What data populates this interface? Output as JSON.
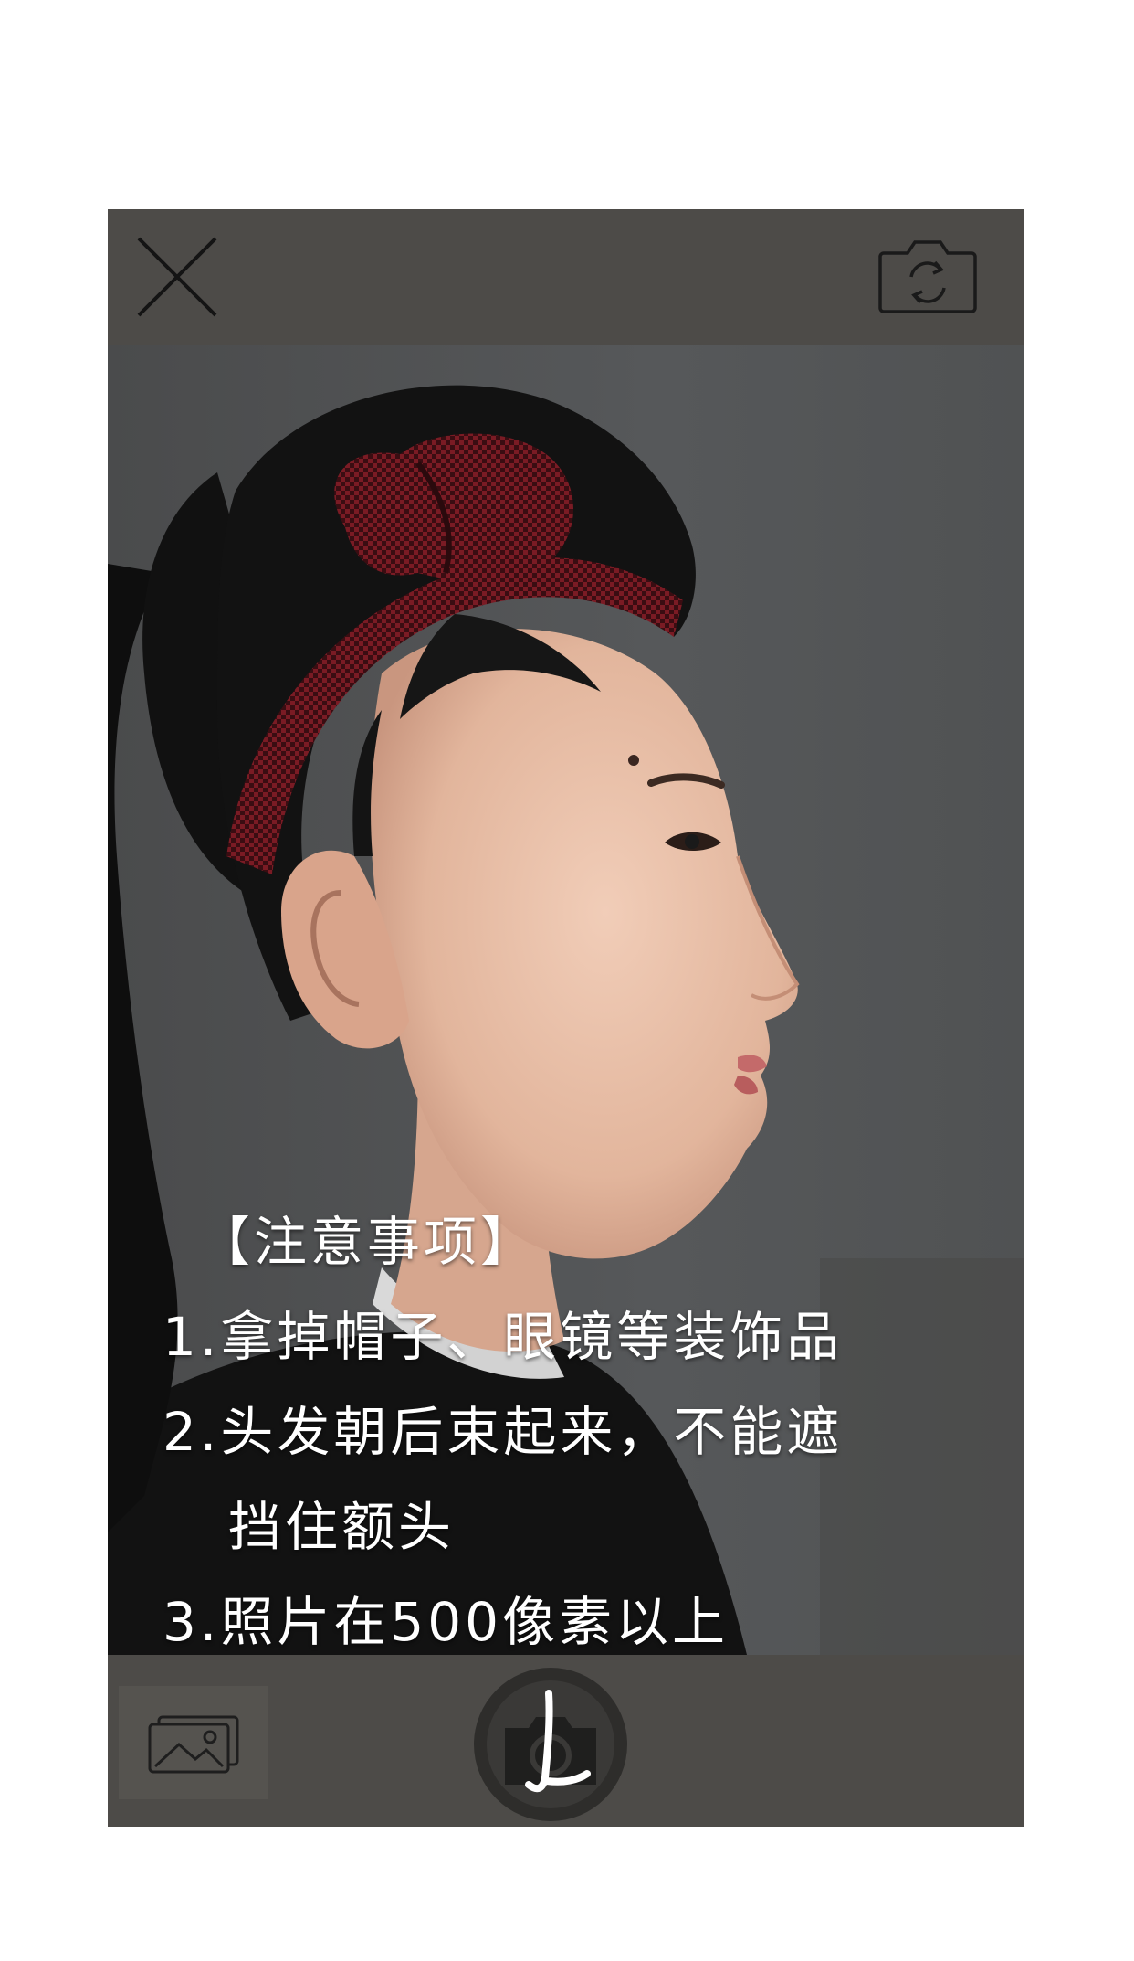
{
  "icons": {
    "close": "close-icon",
    "switch_camera": "camera-switch-icon",
    "gallery": "gallery-icon",
    "shutter": "shutter-camera-icon"
  },
  "colors": {
    "bar_background": "#4d4b48",
    "overlay_text": "#ffffff"
  },
  "tips": {
    "title": "【注意事项】",
    "items": [
      "1.拿掉帽子、眼镜等装饰品",
      "2.头发朝后束起来，不能遮",
      "挡住额头",
      "3.照片在500像素以上"
    ]
  }
}
